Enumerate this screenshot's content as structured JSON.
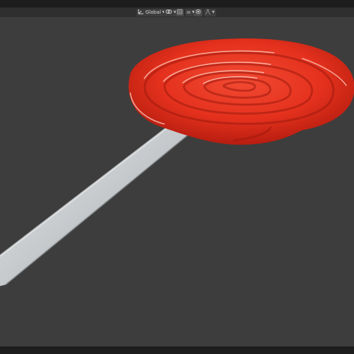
{
  "header": {
    "transform_orientation": {
      "icon": "transform-orientation-icon",
      "label": "Global"
    },
    "pivot": {
      "icon": "pivot-point-icon"
    },
    "snap": {
      "icon": "snap-icon",
      "label": "ııı"
    },
    "proportional": {
      "icon": "proportional-editing-icon"
    },
    "falloff": {
      "icon": "falloff-curve-icon"
    }
  },
  "scene": {
    "objects": [
      {
        "name": "lollipop-candy",
        "color": "#e8321f"
      },
      {
        "name": "lollipop-stick",
        "color": "#c8cccf"
      }
    ]
  },
  "colors": {
    "viewport_bg": "#3d3d3d",
    "header_bg": "#2f2f2f",
    "candy": "#e8321f",
    "stick": "#c8cccf"
  }
}
